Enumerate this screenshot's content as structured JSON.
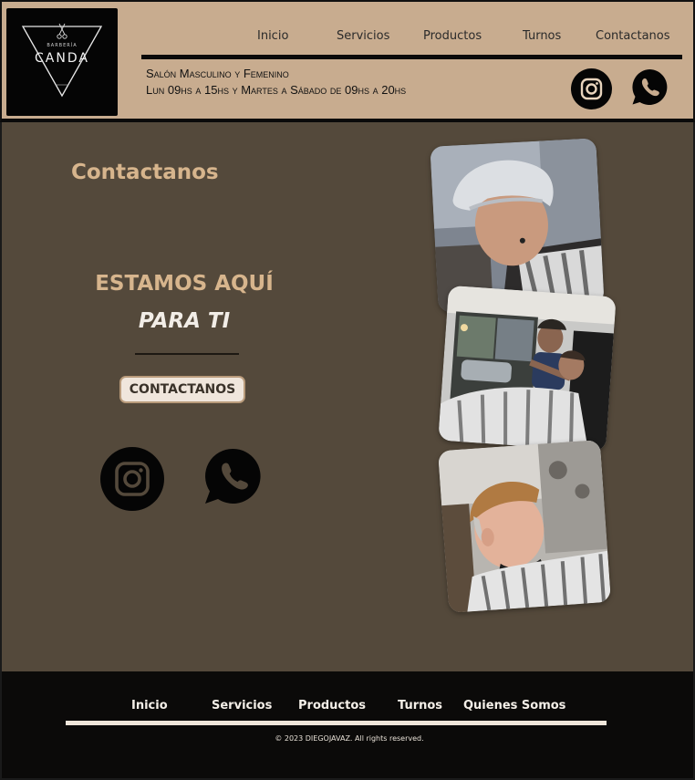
{
  "header": {
    "logo": {
      "small_text": "BARBERÍA",
      "brand": "CANDA",
      "icon": "scissors-icon"
    },
    "nav": [
      "Inicio",
      "Servicios",
      "Productos",
      "Turnos",
      "Contactanos"
    ],
    "info_line1": "Salón Masculino y Femenino",
    "info_line2": "Lun 09hs a 15hs y Martes a Sábado de 09hs a 20hs",
    "icons": [
      "instagram-icon",
      "whatsapp-icon"
    ]
  },
  "main": {
    "title": "Contactanos",
    "hero_line1": "ESTAMOS AQUÍ",
    "hero_line2": "PARA TI",
    "cta_label": "CONTACTANOS",
    "icons": [
      "instagram-icon",
      "whatsapp-icon"
    ],
    "photos": [
      "barber-photo-1",
      "barber-photo-2",
      "barber-photo-3"
    ]
  },
  "footer": {
    "nav": [
      "Inicio",
      "Servicios",
      "Productos",
      "Turnos",
      "Quienes Somos"
    ],
    "copyright": "© 2023 DIEGOJAVAZ.  All rights reserved."
  },
  "colors": {
    "header_bg": "#c8ac8f",
    "main_bg": "#54493b",
    "accent_tan": "#d7b58d",
    "footer_bg": "#0b0a09"
  }
}
